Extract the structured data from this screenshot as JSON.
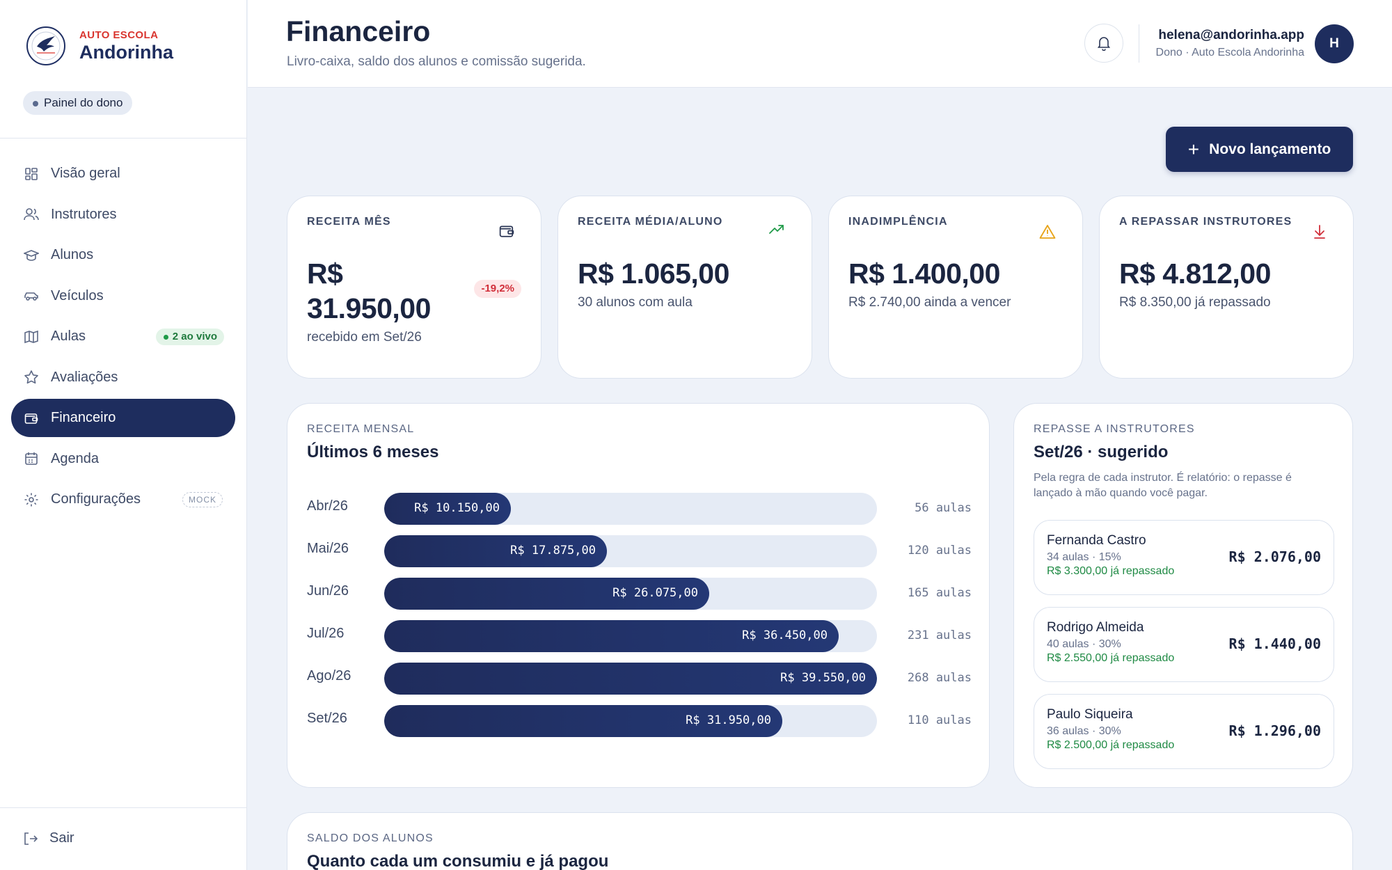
{
  "brand": {
    "top": "AUTO ESCOLA",
    "name": "Andorinha",
    "logo_text": "ANDORINHA"
  },
  "sidebar": {
    "chip": "Painel do dono",
    "items": [
      {
        "label": "Visão geral",
        "icon": "grid-icon"
      },
      {
        "label": "Instrutores",
        "icon": "users-icon"
      },
      {
        "label": "Alunos",
        "icon": "graduation-cap-icon"
      },
      {
        "label": "Veículos",
        "icon": "car-icon"
      },
      {
        "label": "Aulas",
        "icon": "map-icon",
        "badge": "2 ao vivo"
      },
      {
        "label": "Avaliações",
        "icon": "star-icon"
      },
      {
        "label": "Financeiro",
        "icon": "wallet-icon",
        "active": true
      },
      {
        "label": "Agenda",
        "icon": "calendar-icon"
      },
      {
        "label": "Configurações",
        "icon": "gear-icon",
        "badge": "MOCK"
      }
    ],
    "logout": "Sair"
  },
  "header": {
    "title": "Financeiro",
    "subtitle": "Livro-caixa, saldo dos alunos e comissão sugerida.",
    "user_email": "helena@andorinha.app",
    "user_role": "Dono · Auto Escola Andorinha",
    "avatar": "H"
  },
  "actions": {
    "new_entry": "Novo lançamento"
  },
  "kpis": [
    {
      "label": "RECEITA MÊS",
      "value": "R$ 31.950,00",
      "sub": "recebido em Set/26",
      "delta": "-19,2%",
      "icon": "wallet-icon",
      "icon_color": "#2a3554"
    },
    {
      "label": "RECEITA MÉDIA/ALUNO",
      "value": "R$ 1.065,00",
      "sub": "30 alunos com aula",
      "icon": "trending-up-icon",
      "icon_color": "#1f9a48"
    },
    {
      "label": "INADIMPLÊNCIA",
      "value": "R$ 1.400,00",
      "sub": "R$ 2.740,00 ainda a vencer",
      "icon": "warning-icon",
      "icon_color": "#e8a317"
    },
    {
      "label": "A REPASSAR INSTRUTORES",
      "value": "R$ 4.812,00",
      "sub": "R$ 8.350,00 já repassado",
      "icon": "download-icon",
      "icon_color": "#d12f3a"
    }
  ],
  "revenue": {
    "label": "RECEITA MENSAL",
    "title": "Últimos 6 meses",
    "rows": [
      {
        "month": "Abr/26",
        "amount": "R$ 10.150,00",
        "value": 10150,
        "count": "56 aulas"
      },
      {
        "month": "Mai/26",
        "amount": "R$ 17.875,00",
        "value": 17875,
        "count": "120 aulas"
      },
      {
        "month": "Jun/26",
        "amount": "R$ 26.075,00",
        "value": 26075,
        "count": "165 aulas"
      },
      {
        "month": "Jul/26",
        "amount": "R$ 36.450,00",
        "value": 36450,
        "count": "231 aulas"
      },
      {
        "month": "Ago/26",
        "amount": "R$ 39.550,00",
        "value": 39550,
        "count": "268 aulas"
      },
      {
        "month": "Set/26",
        "amount": "R$ 31.950,00",
        "value": 31950,
        "count": "110 aulas"
      }
    ]
  },
  "repasse": {
    "label": "REPASSE A INSTRUTORES",
    "title": "Set/26 · sugerido",
    "desc": "Pela regra de cada instrutor. É relatório: o repasse é lançado à mão quando você pagar.",
    "items": [
      {
        "name": "Fernanda Castro",
        "meta": "34 aulas · 15%",
        "paid": "R$ 3.300,00 já repassado",
        "amount": "R$ 2.076,00"
      },
      {
        "name": "Rodrigo Almeida",
        "meta": "40 aulas · 30%",
        "paid": "R$ 2.550,00 já repassado",
        "amount": "R$ 1.440,00"
      },
      {
        "name": "Paulo Siqueira",
        "meta": "36 aulas · 30%",
        "paid": "R$ 2.500,00 já repassado",
        "amount": "R$ 1.296,00"
      }
    ]
  },
  "saldo": {
    "label": "SALDO DOS ALUNOS",
    "title": "Quanto cada um consumiu e já pagou"
  }
}
